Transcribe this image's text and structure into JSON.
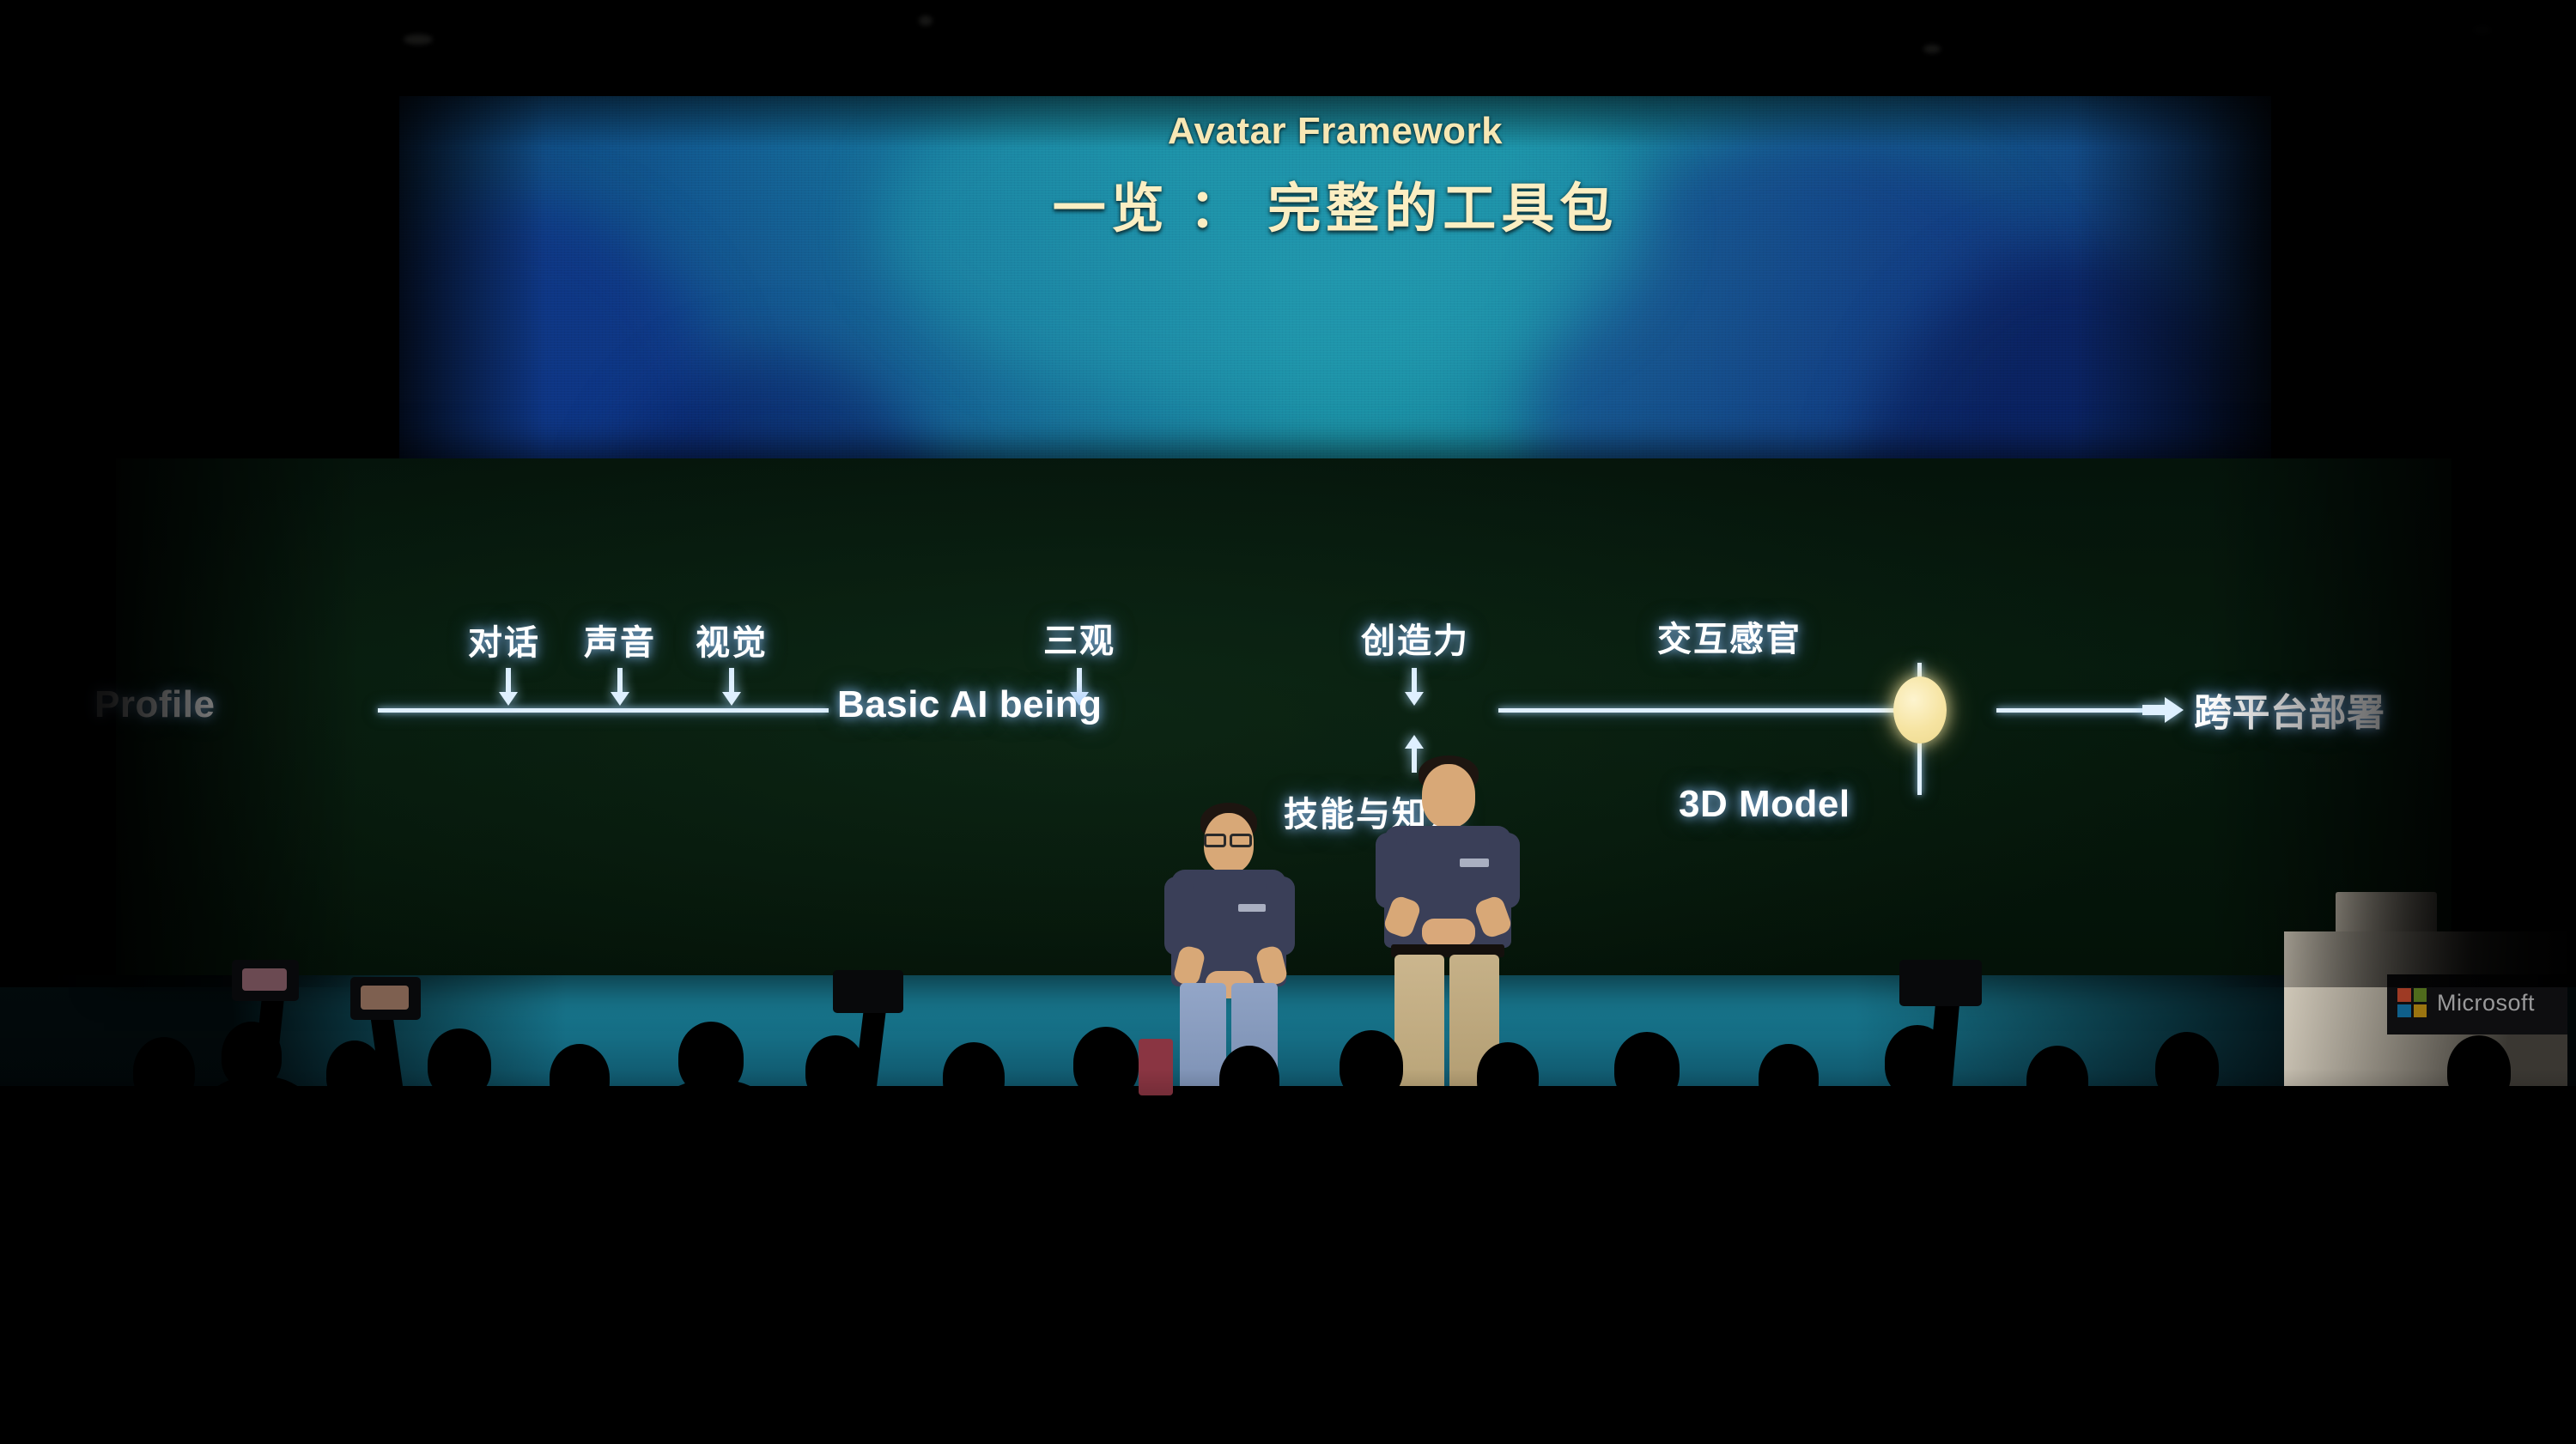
{
  "scene": {
    "kind": "conference-keynote-stage",
    "brand_on_podium": "Microsoft"
  },
  "slide": {
    "title_en": "Avatar Framework",
    "title_cn": "一览 ： 完整的工具包",
    "title_color": "#F7E7B4",
    "band_color": "#05140B"
  },
  "diagram": {
    "nodes": [
      {
        "id": "profile",
        "label": "Profile"
      },
      {
        "id": "basic-ai-being",
        "label": "Basic AI being"
      },
      {
        "id": "cross-platform",
        "label": "跨平台部署"
      }
    ],
    "top_labels": [
      {
        "id": "dialogue",
        "label": "对话"
      },
      {
        "id": "voice",
        "label": "声音"
      },
      {
        "id": "vision",
        "label": "视觉"
      },
      {
        "id": "worldview",
        "label": "三观"
      },
      {
        "id": "creativity",
        "label": "创造力"
      },
      {
        "id": "interaction",
        "label": "交互感官"
      }
    ],
    "bottom_labels": [
      {
        "id": "skills-knowledge",
        "label": "技能与知识"
      },
      {
        "id": "three-d-model",
        "label": "3D Model"
      }
    ],
    "node_marker_color": "#F6E4A2",
    "line_color": "#DFF0FF"
  },
  "podium": {
    "wordmark": "Microsoft",
    "logo_colors": [
      "#f25022",
      "#7fba00",
      "#00a4ef",
      "#ffb900"
    ]
  },
  "stage": {
    "presenters": [
      {
        "id": "presenter-left",
        "shirt": "#3A3F58",
        "pants": "#8FA2C4",
        "glasses": true
      },
      {
        "id": "presenter-right",
        "shirt": "#3A3F58",
        "pants": "#C4B089",
        "glasses": false
      }
    ]
  }
}
